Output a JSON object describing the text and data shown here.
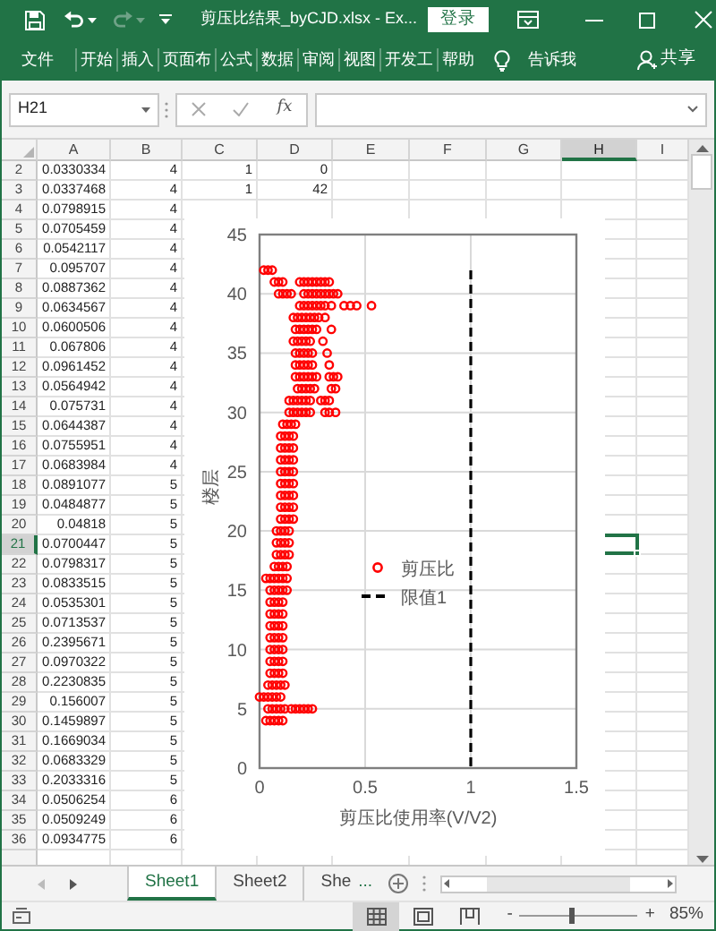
{
  "title_bar": {
    "title": "剪压比结果_byCJD.xlsx  -  Ex...",
    "sign_in": "登录"
  },
  "ribbon_tabs": [
    "文件",
    "开始",
    "插入",
    "页面布",
    "公式",
    "数据",
    "审阅",
    "视图",
    "开发工",
    "帮助"
  ],
  "tell_me": "告诉我",
  "share": "共享",
  "formula_bar": {
    "name_box": "H21",
    "function_label": "fx"
  },
  "sheet": {
    "columns": [
      {
        "label": "A",
        "selected": false
      },
      {
        "label": "B",
        "selected": false
      },
      {
        "label": "C",
        "selected": false
      },
      {
        "label": "D",
        "selected": false
      },
      {
        "label": "E",
        "selected": false
      },
      {
        "label": "F",
        "selected": false
      },
      {
        "label": "G",
        "selected": false
      },
      {
        "label": "H",
        "selected": true
      },
      {
        "label": "I",
        "selected": false
      }
    ],
    "rows": [
      {
        "number": "2",
        "selected": false,
        "cells": [
          "0.0330334",
          "4",
          "1",
          "0"
        ]
      },
      {
        "number": "3",
        "selected": false,
        "cells": [
          "0.0337468",
          "4",
          "1",
          "42"
        ]
      },
      {
        "number": "4",
        "selected": false,
        "cells": [
          "0.0798915",
          "4"
        ]
      },
      {
        "number": "5",
        "selected": false,
        "cells": [
          "0.0705459",
          "4"
        ]
      },
      {
        "number": "6",
        "selected": false,
        "cells": [
          "0.0542117",
          "4"
        ]
      },
      {
        "number": "7",
        "selected": false,
        "cells": [
          "0.095707",
          "4"
        ]
      },
      {
        "number": "8",
        "selected": false,
        "cells": [
          "0.0887362",
          "4"
        ]
      },
      {
        "number": "9",
        "selected": false,
        "cells": [
          "0.0634567",
          "4"
        ]
      },
      {
        "number": "10",
        "selected": false,
        "cells": [
          "0.0600506",
          "4"
        ]
      },
      {
        "number": "11",
        "selected": false,
        "cells": [
          "0.067806",
          "4"
        ]
      },
      {
        "number": "12",
        "selected": false,
        "cells": [
          "0.0961452",
          "4"
        ]
      },
      {
        "number": "13",
        "selected": false,
        "cells": [
          "0.0564942",
          "4"
        ]
      },
      {
        "number": "14",
        "selected": false,
        "cells": [
          "0.075731",
          "4"
        ]
      },
      {
        "number": "15",
        "selected": false,
        "cells": [
          "0.0644387",
          "4"
        ]
      },
      {
        "number": "16",
        "selected": false,
        "cells": [
          "0.0755951",
          "4"
        ]
      },
      {
        "number": "17",
        "selected": false,
        "cells": [
          "0.0683984",
          "4"
        ]
      },
      {
        "number": "18",
        "selected": false,
        "cells": [
          "0.0891077",
          "5"
        ]
      },
      {
        "number": "19",
        "selected": false,
        "cells": [
          "0.0484877",
          "5"
        ]
      },
      {
        "number": "20",
        "selected": false,
        "cells": [
          "0.04818",
          "5"
        ]
      },
      {
        "number": "21",
        "selected": true,
        "cells": [
          "0.0700447",
          "5"
        ]
      },
      {
        "number": "22",
        "selected": false,
        "cells": [
          "0.0798317",
          "5"
        ]
      },
      {
        "number": "23",
        "selected": false,
        "cells": [
          "0.0833515",
          "5"
        ]
      },
      {
        "number": "24",
        "selected": false,
        "cells": [
          "0.0535301",
          "5"
        ]
      },
      {
        "number": "25",
        "selected": false,
        "cells": [
          "0.0713537",
          "5"
        ]
      },
      {
        "number": "26",
        "selected": false,
        "cells": [
          "0.2395671",
          "5"
        ]
      },
      {
        "number": "27",
        "selected": false,
        "cells": [
          "0.0970322",
          "5"
        ]
      },
      {
        "number": "28",
        "selected": false,
        "cells": [
          "0.2230835",
          "5"
        ]
      },
      {
        "number": "29",
        "selected": false,
        "cells": [
          "0.156007",
          "5"
        ]
      },
      {
        "number": "30",
        "selected": false,
        "cells": [
          "0.1459897",
          "5"
        ]
      },
      {
        "number": "31",
        "selected": false,
        "cells": [
          "0.1669034",
          "5"
        ]
      },
      {
        "number": "32",
        "selected": false,
        "cells": [
          "0.0683329",
          "5"
        ]
      },
      {
        "number": "33",
        "selected": false,
        "cells": [
          "0.2033316",
          "5"
        ]
      },
      {
        "number": "34",
        "selected": false,
        "cells": [
          "0.0506254",
          "6"
        ]
      },
      {
        "number": "35",
        "selected": false,
        "cells": [
          "0.0509249",
          "6"
        ]
      },
      {
        "number": "36",
        "selected": false,
        "cells": [
          "0.0934775",
          "6"
        ]
      }
    ]
  },
  "chart": {
    "chart_data": {
      "type": "scatter",
      "grid": true,
      "xlabel": "剪压比使用率(V/V2)",
      "ylabel": "楼层",
      "xlim": [
        0,
        1.5
      ],
      "ylim": [
        0,
        45
      ],
      "xticks": [
        0,
        0.5,
        1,
        1.5
      ],
      "yticks": [
        0,
        5,
        10,
        15,
        20,
        25,
        30,
        35,
        40,
        45
      ],
      "series": [
        {
          "name": "剪压比",
          "color": "#ff0000",
          "x": [
            0.02,
            0.04,
            0.06,
            0.07,
            0.09,
            0.11,
            0.19,
            0.21,
            0.23,
            0.25,
            0.27,
            0.29,
            0.31,
            0.33,
            0.09,
            0.11,
            0.13,
            0.15,
            0.21,
            0.23,
            0.25,
            0.27,
            0.29,
            0.31,
            0.33,
            0.35,
            0.37,
            0.19,
            0.21,
            0.23,
            0.25,
            0.27,
            0.29,
            0.31,
            0.34,
            0.4,
            0.43,
            0.46,
            0.53,
            0.16,
            0.18,
            0.2,
            0.22,
            0.24,
            0.26,
            0.28,
            0.31,
            0.17,
            0.19,
            0.21,
            0.23,
            0.25,
            0.27,
            0.34,
            0.16,
            0.18,
            0.2,
            0.22,
            0.24,
            0.3,
            0.17,
            0.19,
            0.21,
            0.23,
            0.25,
            0.32,
            0.17,
            0.19,
            0.21,
            0.23,
            0.25,
            0.33,
            0.17,
            0.19,
            0.21,
            0.23,
            0.25,
            0.27,
            0.33,
            0.35,
            0.37,
            0.18,
            0.2,
            0.22,
            0.24,
            0.26,
            0.34,
            0.36,
            0.14,
            0.16,
            0.18,
            0.2,
            0.22,
            0.24,
            0.29,
            0.31,
            0.33,
            0.14,
            0.16,
            0.18,
            0.2,
            0.22,
            0.24,
            0.31,
            0.33,
            0.36,
            0.11,
            0.13,
            0.15,
            0.17,
            0.1,
            0.12,
            0.14,
            0.16,
            0.1,
            0.12,
            0.14,
            0.16,
            0.1,
            0.12,
            0.14,
            0.16,
            0.1,
            0.12,
            0.14,
            0.16,
            0.1,
            0.12,
            0.14,
            0.16,
            0.1,
            0.12,
            0.14,
            0.16,
            0.1,
            0.12,
            0.14,
            0.16,
            0.1,
            0.12,
            0.14,
            0.16,
            0.08,
            0.1,
            0.12,
            0.14,
            0.08,
            0.1,
            0.12,
            0.14,
            0.08,
            0.1,
            0.12,
            0.14,
            0.07,
            0.09,
            0.11,
            0.13,
            0.03,
            0.05,
            0.07,
            0.09,
            0.11,
            0.13,
            0.05,
            0.07,
            0.09,
            0.11,
            0.13,
            0.05,
            0.07,
            0.09,
            0.11,
            0.05,
            0.07,
            0.09,
            0.11,
            0.05,
            0.07,
            0.09,
            0.11,
            0.05,
            0.07,
            0.09,
            0.11,
            0.05,
            0.07,
            0.09,
            0.11,
            0.05,
            0.07,
            0.09,
            0.11,
            0.05,
            0.07,
            0.09,
            0.11,
            0.04,
            0.06,
            0.08,
            0.1,
            0.12,
            0,
            0.02,
            0.04,
            0.06,
            0.08,
            0.1,
            0.04,
            0.06,
            0.08,
            0.1,
            0.12,
            0.15,
            0.17,
            0.19,
            0.21,
            0.23,
            0.25,
            0.03,
            0.05,
            0.07,
            0.09,
            0.11
          ],
          "values": [
            42,
            42,
            42,
            41,
            41,
            41,
            41,
            41,
            41,
            41,
            41,
            41,
            41,
            41,
            40,
            40,
            40,
            40,
            40,
            40,
            40,
            40,
            40,
            40,
            40,
            40,
            40,
            39,
            39,
            39,
            39,
            39,
            39,
            39,
            39,
            39,
            39,
            39,
            39,
            38,
            38,
            38,
            38,
            38,
            38,
            38,
            38,
            37,
            37,
            37,
            37,
            37,
            37,
            37,
            36,
            36,
            36,
            36,
            36,
            36,
            35,
            35,
            35,
            35,
            35,
            35,
            34,
            34,
            34,
            34,
            34,
            34,
            33,
            33,
            33,
            33,
            33,
            33,
            33,
            33,
            33,
            32,
            32,
            32,
            32,
            32,
            32,
            32,
            31,
            31,
            31,
            31,
            31,
            31,
            31,
            31,
            31,
            30,
            30,
            30,
            30,
            30,
            30,
            30,
            30,
            30,
            29,
            29,
            29,
            29,
            28,
            28,
            28,
            28,
            27,
            27,
            27,
            27,
            26,
            26,
            26,
            26,
            25,
            25,
            25,
            25,
            24,
            24,
            24,
            24,
            23,
            23,
            23,
            23,
            22,
            22,
            22,
            22,
            21,
            21,
            21,
            21,
            20,
            20,
            20,
            20,
            19,
            19,
            19,
            19,
            18,
            18,
            18,
            18,
            17,
            17,
            17,
            17,
            16,
            16,
            16,
            16,
            16,
            16,
            15,
            15,
            15,
            15,
            15,
            14,
            14,
            14,
            14,
            13,
            13,
            13,
            13,
            12,
            12,
            12,
            12,
            11,
            11,
            11,
            11,
            10,
            10,
            10,
            10,
            9,
            9,
            9,
            9,
            8,
            8,
            8,
            8,
            7,
            7,
            7,
            7,
            7,
            6,
            6,
            6,
            6,
            6,
            6,
            5,
            5,
            5,
            5,
            5,
            5,
            5,
            5,
            5,
            5,
            5,
            4,
            4,
            4,
            4,
            4
          ]
        }
      ],
      "ref_lines": [
        {
          "axis": "x",
          "value": 1,
          "label": "限值1",
          "color": "#000000"
        }
      ]
    }
  },
  "sheet_tabs": [
    {
      "label": "Sheet1",
      "selected": true
    },
    {
      "label": "Sheet2",
      "selected": false
    },
    {
      "label": "She",
      "selected": false
    }
  ],
  "more_tabs": "...",
  "status_bar": {
    "views": [
      {
        "kind": "normal",
        "selected": true
      },
      {
        "kind": "page_layout",
        "selected": false
      },
      {
        "kind": "page_break",
        "selected": false
      }
    ],
    "zoom_out": "-",
    "zoom_in": "+",
    "zoom_slider": {
      "level": 0.43
    },
    "zoom_label": "85%"
  }
}
